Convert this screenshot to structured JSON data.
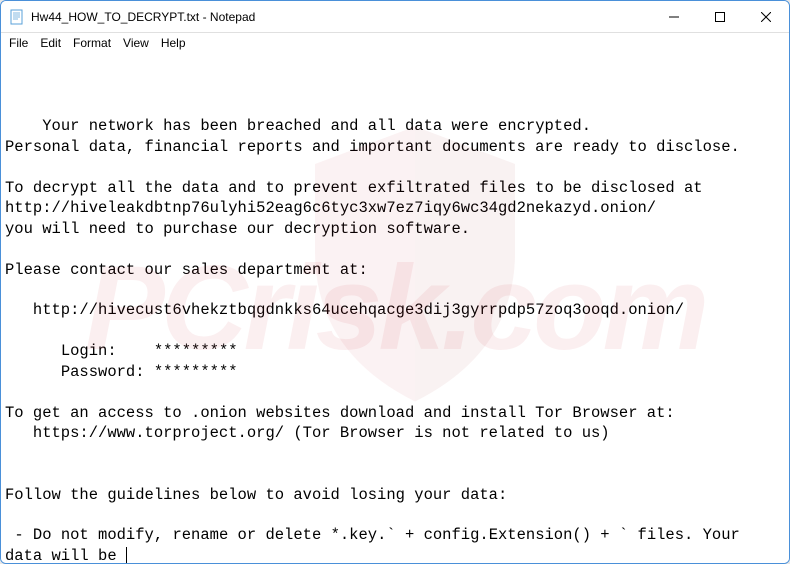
{
  "window": {
    "title": "Hw44_HOW_TO_DECRYPT.txt - Notepad"
  },
  "menubar": {
    "items": [
      "File",
      "Edit",
      "Format",
      "View",
      "Help"
    ]
  },
  "content": {
    "text": "Your network has been breached and all data were encrypted.\nPersonal data, financial reports and important documents are ready to disclose.\n\nTo decrypt all the data and to prevent exfiltrated files to be disclosed at \nhttp://hiveleakdbtnp76ulyhi52eag6c6tyc3xw7ez7iqy6wc34gd2nekazyd.onion/\nyou will need to purchase our decryption software.\n\nPlease contact our sales department at:\n\n   http://hivecust6vhekztbqgdnkks64ucehqacge3dij3gyrrpdp57zoq3ooqd.onion/\n\n      Login:    *********\n      Password: *********\n\nTo get an access to .onion websites download and install Tor Browser at:\n   https://www.torproject.org/ (Tor Browser is not related to us)\n\n\nFollow the guidelines below to avoid losing your data:\n\n - Do not modify, rename or delete *.key.` + config.Extension() + ` files. Your data will be "
  },
  "watermark": {
    "text": "PCrisk.com"
  }
}
